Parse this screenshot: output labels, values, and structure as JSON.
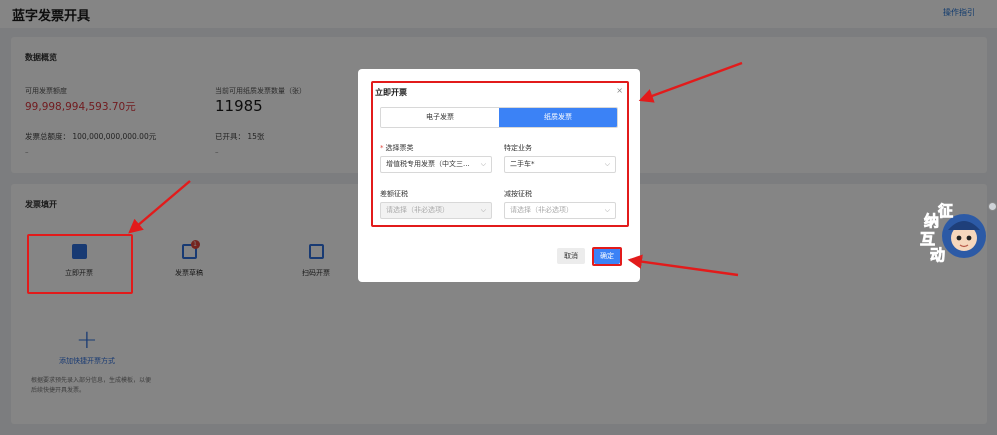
{
  "header": {
    "title": "蓝字发票开具",
    "help_link": "操作指引"
  },
  "overview": {
    "title": "数据概览",
    "available_amount_label": "可用发票额度",
    "available_amount_value": "99,998,994,593.70元",
    "paper_count_label": "当前可用纸质发票数量（张）",
    "paper_count_value": "11985",
    "total_amount_text": "发票总额度：  100,000,000,000.00元",
    "issued_text": "已开具：  15张",
    "dash_left": "–",
    "dash_right": "–"
  },
  "invoice_fill": {
    "title": "发票填开",
    "tools": [
      {
        "label": "立即开票",
        "icon": "instant-invoice-icon"
      },
      {
        "label": "发票草稿",
        "icon": "draft-icon",
        "badge": "1"
      },
      {
        "label": "扫码开票",
        "icon": "scan-code-icon"
      }
    ],
    "add_quick_label": "添加快捷开票方式",
    "add_quick_desc": "根据要求预先录入部分信息，生成模板，以便后续快捷开具发票。"
  },
  "modal": {
    "title": "立即开票",
    "close_glyph": "×",
    "tabs": [
      {
        "label": "电子发票",
        "active": false
      },
      {
        "label": "纸质发票",
        "active": true
      }
    ],
    "fields": {
      "invoice_type": {
        "label": "选择票类",
        "required_mark": "*",
        "value": "增值税专用发票（中文三..."
      },
      "special_business": {
        "label": "特定业务",
        "value": "二手车*"
      },
      "differential_tax": {
        "label": "差额征税",
        "placeholder": "请选择（非必选项）",
        "disabled": true
      },
      "reduced_tax": {
        "label": "减按征税",
        "placeholder": "请选择（非必选项）"
      }
    },
    "cancel_label": "取消",
    "confirm_label": "确定"
  },
  "mascot": {
    "characters": [
      "征",
      "纳",
      "互",
      "动"
    ]
  },
  "colors": {
    "accent": "#3b82f6",
    "annotation_red": "#e21b1b",
    "amount_red": "#d9363e"
  }
}
